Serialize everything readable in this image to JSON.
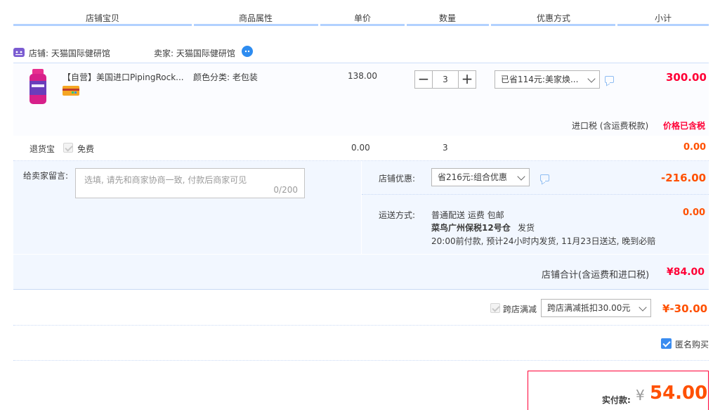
{
  "header": {
    "columns": [
      "店铺宝贝",
      "商品属性",
      "单价",
      "数量",
      "优惠方式",
      "小计"
    ]
  },
  "shop": {
    "label": "店铺: 天猫国际健研馆",
    "seller": "卖家: 天猫国际健研馆"
  },
  "item": {
    "title": "【自营】美国进口PipingRock...",
    "attr": "颜色分类: 老包装",
    "price": "138.00",
    "qty": "3",
    "qty_minus": "−",
    "qty_plus": "+",
    "discount": "已省114元:美家焕...",
    "subtotal": "300.00",
    "tax_label": "进口税 (含运费税款)",
    "tax_value": "价格已含税"
  },
  "return_ins": {
    "label": "退货宝",
    "option": "免费",
    "price": "0.00",
    "qty": "3",
    "subtotal": "0.00"
  },
  "message": {
    "label": "给卖家留言:",
    "placeholder": "选填, 请先和商家协商一致, 付款后商家可见",
    "counter": "0/200"
  },
  "shop_discount": {
    "label": "店铺优惠:",
    "value": "省216元:组合优惠",
    "amount": "-216.00"
  },
  "shipping": {
    "label": "运送方式:",
    "method": "普通配送 运费 包邮",
    "warehouse": "菜鸟广州保税12号仓",
    "ship_word": "发货",
    "eta": "20:00前付款, 预计24小时内发货, 11月23日送达, 晚到必赔",
    "amount": "0.00"
  },
  "shop_total": {
    "label": "店铺合计(含运费和进口税)",
    "amount": "¥84.00"
  },
  "cross_shop": {
    "label": "跨店满减",
    "value": "跨店满减抵扣30.00元",
    "amount": "¥-30.00"
  },
  "anonymous": {
    "label": "匿名购买"
  },
  "payment": {
    "label": "实付款:",
    "currency": "¥",
    "amount": "54.00"
  },
  "colors": {
    "accent_red": "#ff0036",
    "accent_orange": "#ff5000",
    "header_line": "#b2d1ff",
    "block_bg": "#f2f7ff"
  }
}
